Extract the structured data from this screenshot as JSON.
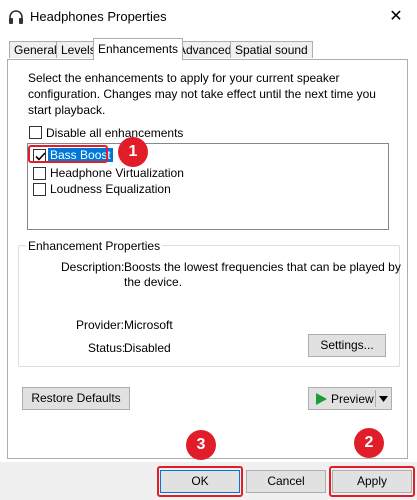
{
  "window": {
    "title": "Headphones Properties",
    "close_glyph": "✕",
    "icon": "headphones-icon"
  },
  "tabs": [
    {
      "label": "General",
      "active": false
    },
    {
      "label": "Levels",
      "active": false
    },
    {
      "label": "Enhancements",
      "active": true
    },
    {
      "label": "Advanced",
      "active": false
    },
    {
      "label": "Spatial sound",
      "active": false
    }
  ],
  "enhancements": {
    "description": "Select the enhancements to apply for your current speaker configuration. Changes may not take effect until the next time you start playback.",
    "disable_all": {
      "label": "Disable all enhancements",
      "checked": false
    },
    "items": [
      {
        "label": "Bass Boost",
        "checked": true,
        "selected": true
      },
      {
        "label": "Headphone Virtualization",
        "checked": false,
        "selected": false
      },
      {
        "label": "Loudness Equalization",
        "checked": false,
        "selected": false
      }
    ]
  },
  "properties": {
    "group_label": "Enhancement Properties",
    "description_label": "Description:",
    "description_value_line1": "Boosts the lowest frequencies that can be played by",
    "description_value_line2": "the device.",
    "provider_label": "Provider:",
    "provider_value": "Microsoft",
    "status_label": "Status:",
    "status_value": "Disabled",
    "settings_button": "Settings..."
  },
  "actions": {
    "restore_defaults": "Restore Defaults",
    "preview": "Preview"
  },
  "footer": {
    "ok": "OK",
    "cancel": "Cancel",
    "apply": "Apply"
  },
  "callouts": {
    "one": "1",
    "two": "2",
    "three": "3",
    "color": "#e11d2a"
  }
}
